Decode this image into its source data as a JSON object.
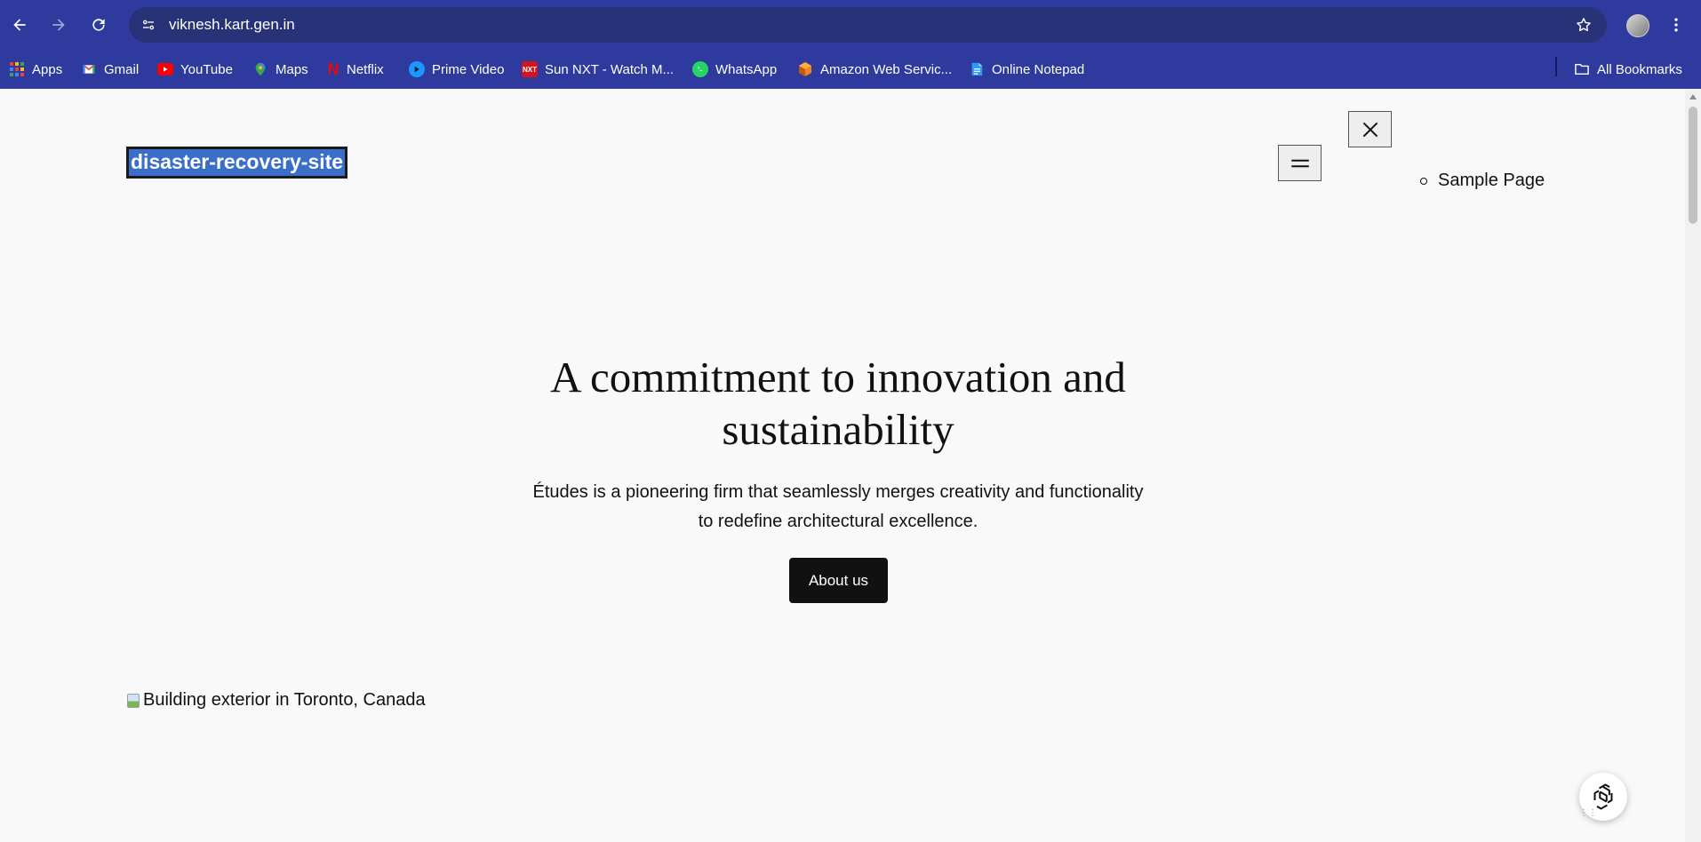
{
  "browser": {
    "url": "viknesh.kart.gen.in",
    "colors": {
      "toolbar": "#2f3a9e",
      "omnibox": "#283278",
      "text": "#ffffff"
    }
  },
  "bookmarks": [
    {
      "label": "Apps",
      "icon": "apps-grid-icon"
    },
    {
      "label": "Gmail",
      "icon": "gmail-icon"
    },
    {
      "label": "YouTube",
      "icon": "youtube-icon"
    },
    {
      "label": "Maps",
      "icon": "maps-icon"
    },
    {
      "label": "Netflix",
      "icon": "netflix-icon"
    },
    {
      "label": "Prime Video",
      "icon": "prime-video-icon"
    },
    {
      "label": "Sun NXT - Watch M...",
      "icon": "sun-nxt-icon"
    },
    {
      "label": "WhatsApp",
      "icon": "whatsapp-icon"
    },
    {
      "label": "Amazon Web Servic...",
      "icon": "aws-icon"
    },
    {
      "label": "Online Notepad",
      "icon": "notepad-icon"
    }
  ],
  "all_bookmarks_label": "All Bookmarks",
  "site": {
    "title": "disaster-recovery-site",
    "nav": [
      "Sample Page"
    ]
  },
  "hero": {
    "heading": "A commitment to innovation and sustainability",
    "subtext": "Études is a pioneering firm that seamlessly merges creativity and functionality to redefine architectural excellence.",
    "button": "About us",
    "image_alt": "Building exterior in Toronto, Canada"
  }
}
